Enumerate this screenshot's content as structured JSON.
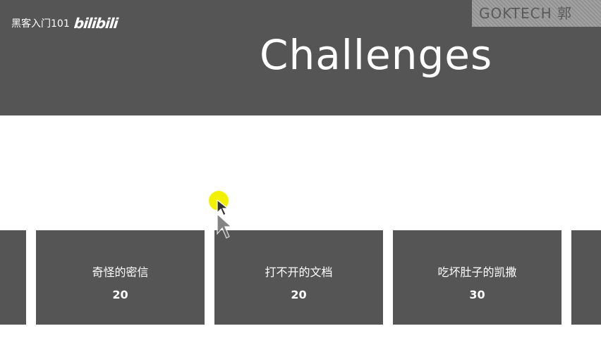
{
  "header": {
    "channel_name": "黑客入门101",
    "brand": "bilibili",
    "title": "Challenges",
    "watermark": "GOKTECH 郭"
  },
  "challenges": [
    {
      "name": "",
      "points": ""
    },
    {
      "name": "奇怪的密信",
      "points": "20"
    },
    {
      "name": "打不开的文档",
      "points": "20"
    },
    {
      "name": "吃坏肚子的凯撒",
      "points": "30"
    },
    {
      "name": "",
      "points": ""
    }
  ],
  "colors": {
    "header_bg": "#555555",
    "card_bg": "#555555",
    "page_bg": "#ffffff",
    "cursor_highlight": "#f2f200"
  },
  "icons": [
    "mouse-pointer-icon",
    "cursor-highlight"
  ]
}
